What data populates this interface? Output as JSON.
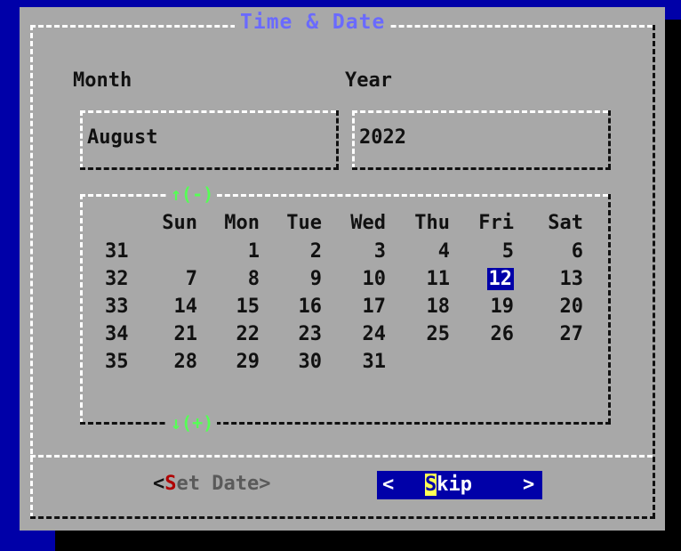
{
  "dialog": {
    "title": "Time & Date",
    "month_label": "Month",
    "year_label": "Year",
    "month_value": "August",
    "year_value": "2022"
  },
  "calendar": {
    "prev_nav": "↑(-)",
    "next_nav": "↓(+)",
    "day_headers": [
      "Sun",
      "Mon",
      "Tue",
      "Wed",
      "Thu",
      "Fri",
      "Sat"
    ],
    "selected_day": "12",
    "weeks": [
      {
        "week": "31",
        "days": [
          "",
          "1",
          "2",
          "3",
          "4",
          "5",
          "6"
        ]
      },
      {
        "week": "32",
        "days": [
          "7",
          "8",
          "9",
          "10",
          "11",
          "12",
          "13"
        ]
      },
      {
        "week": "33",
        "days": [
          "14",
          "15",
          "16",
          "17",
          "18",
          "19",
          "20"
        ]
      },
      {
        "week": "34",
        "days": [
          "21",
          "22",
          "23",
          "24",
          "25",
          "26",
          "27"
        ]
      },
      {
        "week": "35",
        "days": [
          "28",
          "29",
          "30",
          "31",
          "",
          "",
          ""
        ]
      }
    ]
  },
  "buttons": {
    "set_open": "<",
    "set_hotkey": "S",
    "set_rest": "et Date>",
    "skip_open": "<",
    "skip_hotkey": "S",
    "skip_rest": "kip",
    "skip_close": ">"
  },
  "colors": {
    "background": "#0000a8",
    "dialog": "#a8a8a8",
    "title": "#6a6aff",
    "nav_arrows": "#55ff55",
    "hotkey_set": "#b00000",
    "hotkey_skip": "#ffff55"
  }
}
